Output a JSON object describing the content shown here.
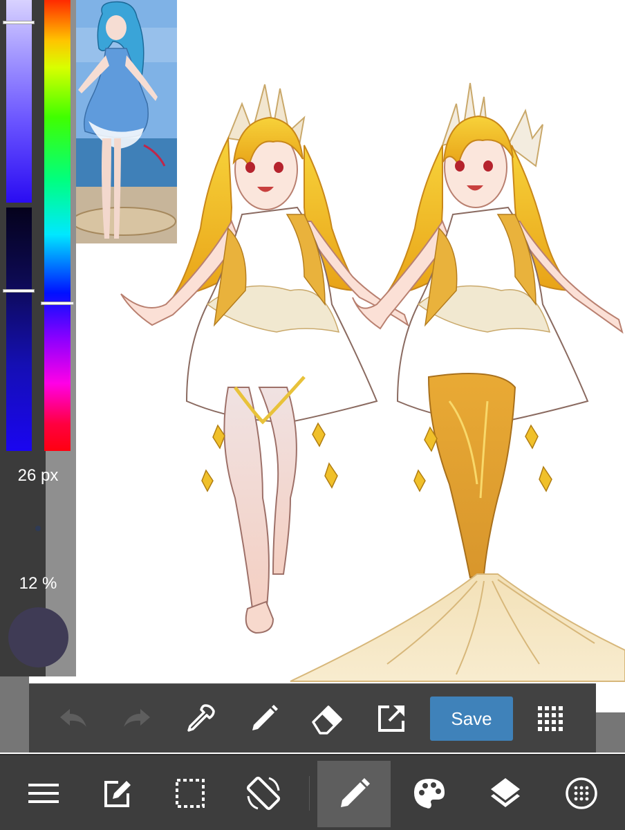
{
  "color_panel": {
    "brush_size": "26 px",
    "opacity": "12 %",
    "current_color": "#3f3b55",
    "hue_handle_fraction": 0.67,
    "brightness_handle_fraction": 0.1,
    "saturation_handle_fraction": 0.33
  },
  "canvas": {
    "content": "angel-girl-illustrations",
    "background": "#ffffff"
  },
  "reference": {
    "content": "blue-haired-girl-reference"
  },
  "action_bar": {
    "undo_icon": "undo-icon",
    "redo_icon": "redo-icon",
    "eyedropper_icon": "eyedropper-icon",
    "pen_icon": "pen-icon",
    "eraser_icon": "eraser-icon",
    "export_icon": "export-icon",
    "save_label": "Save",
    "grid_icon": "grid-icon",
    "save_color": "#3f82ba"
  },
  "bottom_nav": {
    "items": [
      "menu-icon",
      "edit-icon",
      "selection-icon",
      "rotate-icon",
      "brush-icon",
      "palette-icon",
      "layers-icon",
      "materials-icon"
    ],
    "active": "brush-icon"
  }
}
